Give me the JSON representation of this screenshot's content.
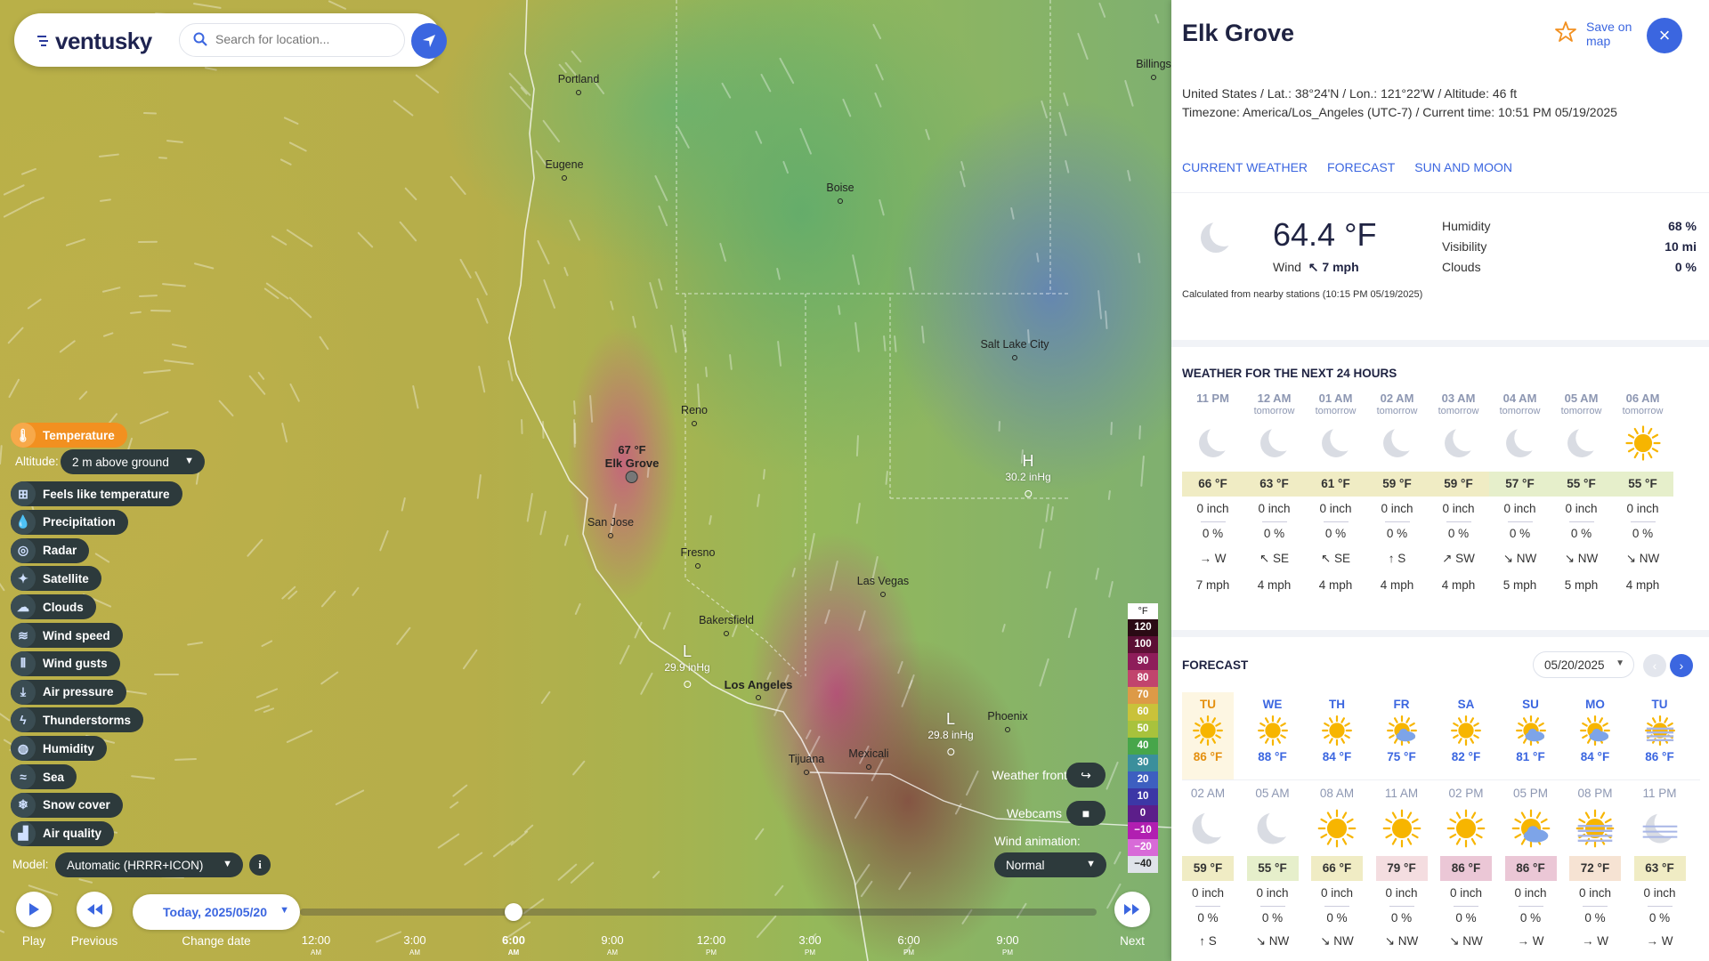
{
  "colors": {
    "accent": "#3b66e0",
    "active_layer": "#f29020",
    "panel_text": "#1f2342"
  },
  "header": {
    "logo": "ventusky",
    "search_placeholder": "Search for location...",
    "locate_icon": "navigation-arrow-icon"
  },
  "map": {
    "cities": [
      {
        "name": "Portland"
      },
      {
        "name": "Eugene"
      },
      {
        "name": "Boise"
      },
      {
        "name": "Billings"
      },
      {
        "name": "Salt Lake City"
      },
      {
        "name": "Reno"
      },
      {
        "name": "San Jose"
      },
      {
        "name": "Fresno"
      },
      {
        "name": "Las Vegas"
      },
      {
        "name": "Bakersfield"
      },
      {
        "name": "Los Angeles"
      },
      {
        "name": "Phoenix"
      },
      {
        "name": "Tijuana"
      },
      {
        "name": "Mexicali"
      }
    ],
    "selected": {
      "temp": "67 °F",
      "name": "Elk Grove"
    },
    "pressure": [
      {
        "letter": "H",
        "value": "30.2 inHg"
      },
      {
        "letter": "L",
        "value": "29.9 inHg"
      },
      {
        "letter": "L",
        "value": "29.8 inHg"
      }
    ]
  },
  "layers": {
    "active": "Temperature",
    "altitude_label": "Altitude:",
    "altitude_value": "2 m above ground",
    "items": [
      {
        "label": "Feels like temperature",
        "icon": "feels-like-icon"
      },
      {
        "label": "Precipitation",
        "icon": "drop-icon"
      },
      {
        "label": "Radar",
        "icon": "radar-icon"
      },
      {
        "label": "Satellite",
        "icon": "satellite-icon"
      },
      {
        "label": "Clouds",
        "icon": "cloud-icon"
      },
      {
        "label": "Wind speed",
        "icon": "wind-icon"
      },
      {
        "label": "Wind gusts",
        "icon": "gusts-icon"
      },
      {
        "label": "Air pressure",
        "icon": "pressure-icon"
      },
      {
        "label": "Thunderstorms",
        "icon": "lightning-icon"
      },
      {
        "label": "Humidity",
        "icon": "humidity-icon"
      },
      {
        "label": "Sea",
        "icon": "waves-icon"
      },
      {
        "label": "Snow cover",
        "icon": "snowflake-icon"
      },
      {
        "label": "Air quality",
        "icon": "factory-icon"
      }
    ],
    "model_label": "Model:",
    "model_value": "Automatic (HRRR+ICON)"
  },
  "map_controls": {
    "weather_fronts": "Weather fronts",
    "webcams": "Webcams",
    "wind_animation_label": "Wind animation:",
    "wind_animation_value": "Normal"
  },
  "legend": {
    "unit": "°F",
    "steps": [
      {
        "v": "120",
        "c": "#2a0a14"
      },
      {
        "v": "100",
        "c": "#5c0f35"
      },
      {
        "v": "90",
        "c": "#8e1d5a"
      },
      {
        "v": "80",
        "c": "#c1446d"
      },
      {
        "v": "70",
        "c": "#dd9a47"
      },
      {
        "v": "60",
        "c": "#c9c23a"
      },
      {
        "v": "50",
        "c": "#a8c23c"
      },
      {
        "v": "40",
        "c": "#47a64a"
      },
      {
        "v": "30",
        "c": "#3b8f9c"
      },
      {
        "v": "20",
        "c": "#3d5fc0"
      },
      {
        "v": "10",
        "c": "#3c37a6"
      },
      {
        "v": "0",
        "c": "#5c1e8a"
      },
      {
        "v": "−10",
        "c": "#b11fb1"
      },
      {
        "v": "−20",
        "c": "#d86ad8"
      },
      {
        "v": "−40",
        "c": "#dfe3ea"
      }
    ]
  },
  "timeline": {
    "play": "Play",
    "previous": "Previous",
    "change_date": "Change date",
    "next": "Next",
    "date_value": "Today, 2025/05/20",
    "ticks": [
      {
        "t": "12:00",
        "ap": "AM"
      },
      {
        "t": "3:00",
        "ap": "AM"
      },
      {
        "t": "6:00",
        "ap": "AM"
      },
      {
        "t": "9:00",
        "ap": "AM"
      },
      {
        "t": "12:00",
        "ap": "PM"
      },
      {
        "t": "3:00",
        "ap": "PM"
      },
      {
        "t": "6:00",
        "ap": "PM"
      },
      {
        "t": "9:00",
        "ap": "PM"
      }
    ],
    "progress": 0.25
  },
  "panel": {
    "title": "Elk Grove",
    "save": "Save on map",
    "location_line": "United States / Lat.: 38°24'N / Lon.: 121°22'W / Altitude: 46 ft",
    "timezone_line": "Timezone: America/Los_Angeles (UTC-7) / Current time: 10:51 PM 05/19/2025",
    "tabs": [
      "CURRENT WEATHER",
      "FORECAST",
      "SUN AND MOON"
    ],
    "current": {
      "temp": "64.4 °F",
      "wind_label": "Wind",
      "wind_value": "7 mph",
      "humidity_label": "Humidity",
      "humidity": "68 %",
      "visibility_label": "Visibility",
      "visibility": "10 mi",
      "clouds_label": "Clouds",
      "clouds": "0 %",
      "note": "Calculated from nearby stations (10:15 PM 05/19/2025)"
    },
    "next24_title": "WEATHER FOR THE NEXT 24 HOURS",
    "next24": [
      {
        "time": "11 PM",
        "sub": "",
        "icon": "moon",
        "temp": "66 °F",
        "tc": "#f0ecc4",
        "rain": "0 inch",
        "pct": "0 %",
        "wind": "→ W",
        "speed": "7 mph"
      },
      {
        "time": "12 AM",
        "sub": "tomorrow",
        "icon": "moon",
        "temp": "63 °F",
        "tc": "#f0ecc4",
        "rain": "0 inch",
        "pct": "0 %",
        "wind": "↖ SE",
        "speed": "4 mph"
      },
      {
        "time": "01 AM",
        "sub": "tomorrow",
        "icon": "moon",
        "temp": "61 °F",
        "tc": "#f0ecc4",
        "rain": "0 inch",
        "pct": "0 %",
        "wind": "↖ SE",
        "speed": "4 mph"
      },
      {
        "time": "02 AM",
        "sub": "tomorrow",
        "icon": "moon",
        "temp": "59 °F",
        "tc": "#f0ecc4",
        "rain": "0 inch",
        "pct": "0 %",
        "wind": "↑ S",
        "speed": "4 mph"
      },
      {
        "time": "03 AM",
        "sub": "tomorrow",
        "icon": "moon",
        "temp": "59 °F",
        "tc": "#f0ecc4",
        "rain": "0 inch",
        "pct": "0 %",
        "wind": "↗ SW",
        "speed": "4 mph"
      },
      {
        "time": "04 AM",
        "sub": "tomorrow",
        "icon": "moon",
        "temp": "57 °F",
        "tc": "#e6efcb",
        "rain": "0 inch",
        "pct": "0 %",
        "wind": "↘ NW",
        "speed": "5 mph"
      },
      {
        "time": "05 AM",
        "sub": "tomorrow",
        "icon": "moon",
        "temp": "55 °F",
        "tc": "#e6efcb",
        "rain": "0 inch",
        "pct": "0 %",
        "wind": "↘ NW",
        "speed": "5 mph"
      },
      {
        "time": "06 AM",
        "sub": "tomorrow",
        "icon": "sun",
        "temp": "55 °F",
        "tc": "#e6efcb",
        "rain": "0 inch",
        "pct": "0 %",
        "wind": "↘ NW",
        "speed": "4 mph"
      }
    ],
    "forecast_title": "FORECAST",
    "forecast_date": "05/20/2025",
    "days": [
      {
        "d": "TU",
        "icon": "sun",
        "t": "86 °F",
        "sel": true
      },
      {
        "d": "WE",
        "icon": "sun",
        "t": "88 °F"
      },
      {
        "d": "TH",
        "icon": "sun",
        "t": "84 °F"
      },
      {
        "d": "FR",
        "icon": "suncloud",
        "t": "75 °F"
      },
      {
        "d": "SA",
        "icon": "sun",
        "t": "82 °F"
      },
      {
        "d": "SU",
        "icon": "suncloud",
        "t": "81 °F"
      },
      {
        "d": "MO",
        "icon": "suncloud",
        "t": "84 °F"
      },
      {
        "d": "TU",
        "icon": "sunhaze",
        "t": "86 °F"
      }
    ],
    "hours": [
      {
        "time": "02 AM",
        "icon": "moon",
        "temp": "59 °F",
        "tc": "#f0ecc4",
        "rain": "0 inch",
        "pct": "0 %",
        "wind": "↑ S"
      },
      {
        "time": "05 AM",
        "icon": "moon",
        "temp": "55 °F",
        "tc": "#e6efcb",
        "rain": "0 inch",
        "pct": "0 %",
        "wind": "↘ NW"
      },
      {
        "time": "08 AM",
        "icon": "sun",
        "temp": "66 °F",
        "tc": "#f0ecc4",
        "rain": "0 inch",
        "pct": "0 %",
        "wind": "↘ NW"
      },
      {
        "time": "11 AM",
        "icon": "sun",
        "temp": "79 °F",
        "tc": "#f4dde0",
        "rain": "0 inch",
        "pct": "0 %",
        "wind": "↘ NW"
      },
      {
        "time": "02 PM",
        "icon": "sun",
        "temp": "86 °F",
        "tc": "#ebc7d6",
        "rain": "0 inch",
        "pct": "0 %",
        "wind": "↘ NW"
      },
      {
        "time": "05 PM",
        "icon": "suncloud",
        "temp": "86 °F",
        "tc": "#ebc7d6",
        "rain": "0 inch",
        "pct": "0 %",
        "wind": "→ W"
      },
      {
        "time": "08 PM",
        "icon": "sunhaze",
        "temp": "72 °F",
        "tc": "#f6e3d3",
        "rain": "0 inch",
        "pct": "0 %",
        "wind": "→ W"
      },
      {
        "time": "11 PM",
        "icon": "moonhaze",
        "temp": "63 °F",
        "tc": "#f0ecc4",
        "rain": "0 inch",
        "pct": "0 %",
        "wind": "→ W"
      }
    ]
  }
}
